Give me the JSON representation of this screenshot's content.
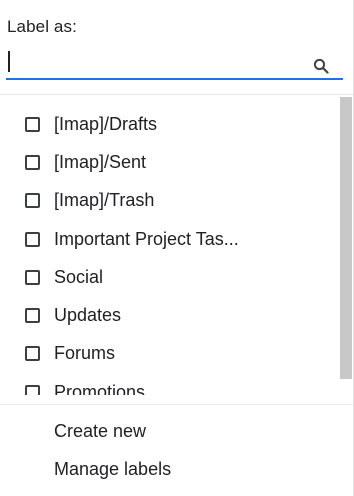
{
  "heading": "Label as:",
  "search": {
    "value": "",
    "placeholder": "",
    "icon": "search-icon"
  },
  "labels": [
    {
      "label": "[Imap]/Drafts",
      "checked": false
    },
    {
      "label": "[Imap]/Sent",
      "checked": false
    },
    {
      "label": "[Imap]/Trash",
      "checked": false
    },
    {
      "label": "Important Project Tas...",
      "checked": false
    },
    {
      "label": "Social",
      "checked": false
    },
    {
      "label": "Updates",
      "checked": false
    },
    {
      "label": "Forums",
      "checked": false
    },
    {
      "label": "Promotions",
      "checked": false
    }
  ],
  "actions": {
    "create_new": "Create new",
    "manage_labels": "Manage labels"
  },
  "colors": {
    "accent": "#1a73e8",
    "text": "#202124",
    "scrollbar": "#c8c8c8"
  }
}
